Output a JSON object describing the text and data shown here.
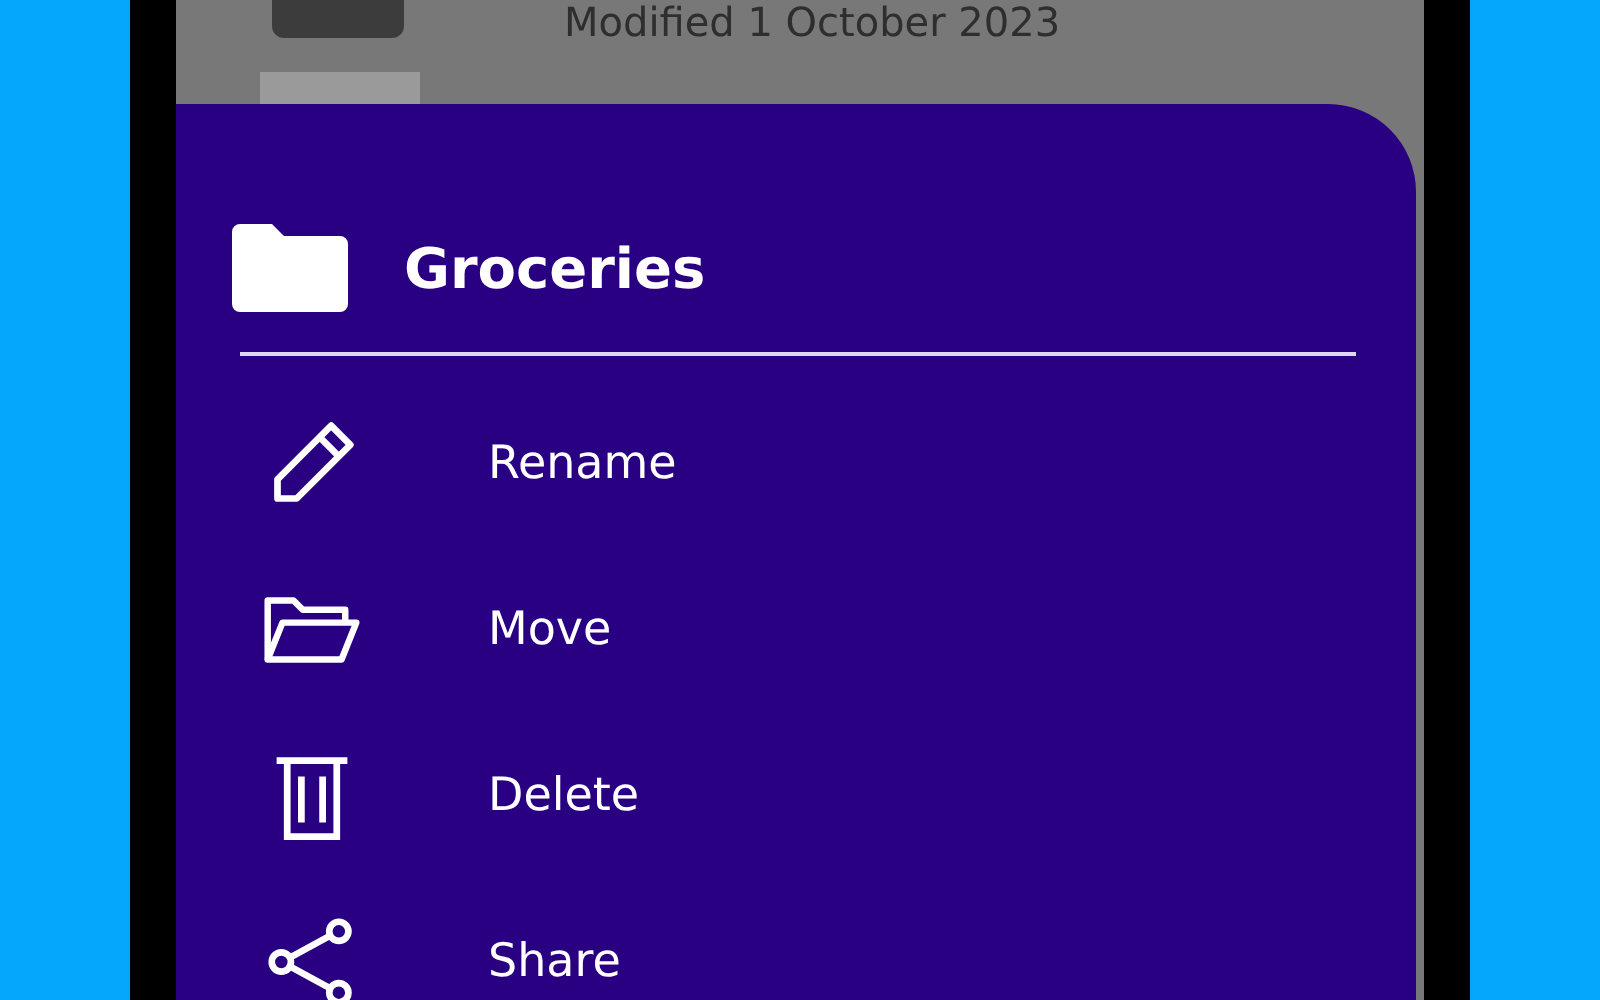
{
  "background_list": [
    {
      "subtitle": "Modified 1 October 2023"
    }
  ],
  "sheet": {
    "title": "Groceries",
    "actions": [
      {
        "label": "Rename",
        "kind": "rename"
      },
      {
        "label": "Move",
        "kind": "move"
      },
      {
        "label": "Delete",
        "kind": "delete"
      },
      {
        "label": "Share",
        "kind": "share"
      }
    ]
  }
}
